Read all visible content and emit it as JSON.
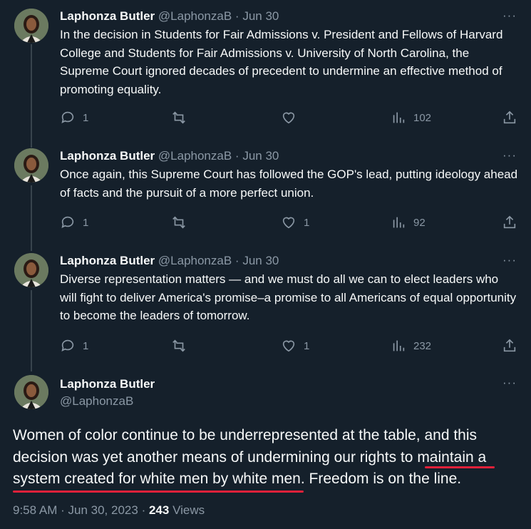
{
  "thread": [
    {
      "name": "Laphonza Butler",
      "handle": "@LaphonzaB",
      "date": "Jun 30",
      "sep": "·",
      "text": "In the decision in Students for Fair Admissions v. President and Fellows of Harvard College and Students for Fair Admissions v. University of North Carolina, the Supreme Court ignored decades of precedent to undermine an effective method of promoting equality.",
      "replies": "1",
      "retweets": "",
      "likes": "",
      "views": "102"
    },
    {
      "name": "Laphonza Butler",
      "handle": "@LaphonzaB",
      "date": "Jun 30",
      "sep": "·",
      "text": "Once again, this Supreme Court has followed the GOP's lead, putting ideology ahead of facts and the pursuit of a more perfect union.",
      "replies": "1",
      "retweets": "",
      "likes": "1",
      "views": "92"
    },
    {
      "name": "Laphonza Butler",
      "handle": "@LaphonzaB",
      "date": "Jun 30",
      "sep": "·",
      "text": "Diverse representation matters — and we must do all we can to elect leaders who will fight to deliver America's promise–a promise to all Americans of equal opportunity to become the leaders of tomorrow.",
      "replies": "1",
      "retweets": "",
      "likes": "1",
      "views": "232"
    }
  ],
  "main": {
    "name": "Laphonza Butler",
    "handle": "@LaphonzaB",
    "text_before": "Women of color continue to be underrepresented at the table, and this decision was yet another means of undermining our rights to ",
    "text_highlight": "maintain a system created for white men by white men",
    "text_after": ". Freedom is on the line.",
    "time": "9:58 AM",
    "date": "Jun 30, 2023",
    "sep": "·",
    "views_count": "243",
    "views_label": "Views"
  },
  "more_label": "···",
  "colors": {
    "background": "#15202b",
    "text": "#f7f9f9",
    "muted": "#8b98a5",
    "underline": "#e0213a"
  },
  "icons": [
    "reply-icon",
    "retweet-icon",
    "like-icon",
    "views-icon",
    "share-icon",
    "more-icon"
  ]
}
